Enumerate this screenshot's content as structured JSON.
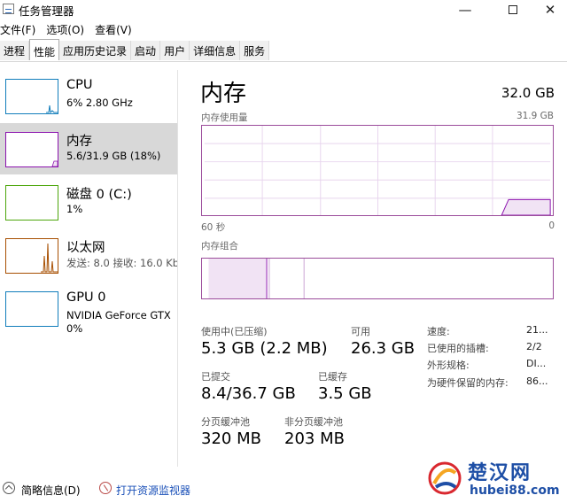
{
  "window": {
    "title": "任务管理器",
    "minimize_glyph": "—",
    "close_glyph": "✕"
  },
  "menu": [
    "文件(F)",
    "选项(O)",
    "查看(V)"
  ],
  "tabs": [
    {
      "label": "进程",
      "active": false
    },
    {
      "label": "性能",
      "active": true
    },
    {
      "label": "应用历史记录",
      "active": false
    },
    {
      "label": "启动",
      "active": false
    },
    {
      "label": "用户",
      "active": false
    },
    {
      "label": "详细信息",
      "active": false
    },
    {
      "label": "服务",
      "active": false
    }
  ],
  "resources": [
    {
      "title": "CPU",
      "line1": "6% 2.80 GHz",
      "line2": "",
      "color": "#117dbb",
      "selected": false
    },
    {
      "title": "内存",
      "line1": "5.6/31.9 GB (18%)",
      "line2": "",
      "color": "#8b12ae",
      "selected": true
    },
    {
      "title": "磁盘 0 (C:)",
      "line1": "1%",
      "line2": "",
      "color": "#4da60c",
      "selected": false
    },
    {
      "title": "以太网",
      "line1": "发送: 8.0  接收: 16.0 Kb",
      "line2": "",
      "color": "#a74f01",
      "selected": false
    },
    {
      "title": "GPU 0",
      "line1": "NVIDIA GeForce GTX",
      "line2": "0%",
      "color": "#117dbb",
      "selected": false
    }
  ],
  "memory": {
    "title": "内存",
    "total": "32.0 GB",
    "usage_label": "内存使用量",
    "usage_max": "31.9 GB",
    "x_left": "60 秒",
    "x_right": "0",
    "composition_label": "内存组合",
    "stats": {
      "in_use_label": "使用中(已压缩)",
      "in_use_value": "5.3 GB (2.2 MB)",
      "available_label": "可用",
      "available_value": "26.3 GB",
      "committed_label": "已提交",
      "committed_value": "8.4/36.7 GB",
      "cached_label": "已缓存",
      "cached_value": "3.5 GB",
      "paged_label": "分页缓冲池",
      "paged_value": "320 MB",
      "nonpaged_label": "非分页缓冲池",
      "nonpaged_value": "203 MB"
    },
    "properties": [
      {
        "label": "速度:",
        "value": "21..."
      },
      {
        "label": "已使用的插槽:",
        "value": "2/2"
      },
      {
        "label": "外形规格:",
        "value": "DI..."
      },
      {
        "label": "为硬件保留的内存:",
        "value": "86..."
      }
    ],
    "graph_color": "#8b12ae",
    "usage_fraction": 0.18
  },
  "footer": {
    "less_details": "简略信息(D)",
    "open_monitor": "打开资源监视器"
  },
  "watermark": {
    "text": "楚汉网",
    "url": "hubei88.com"
  }
}
